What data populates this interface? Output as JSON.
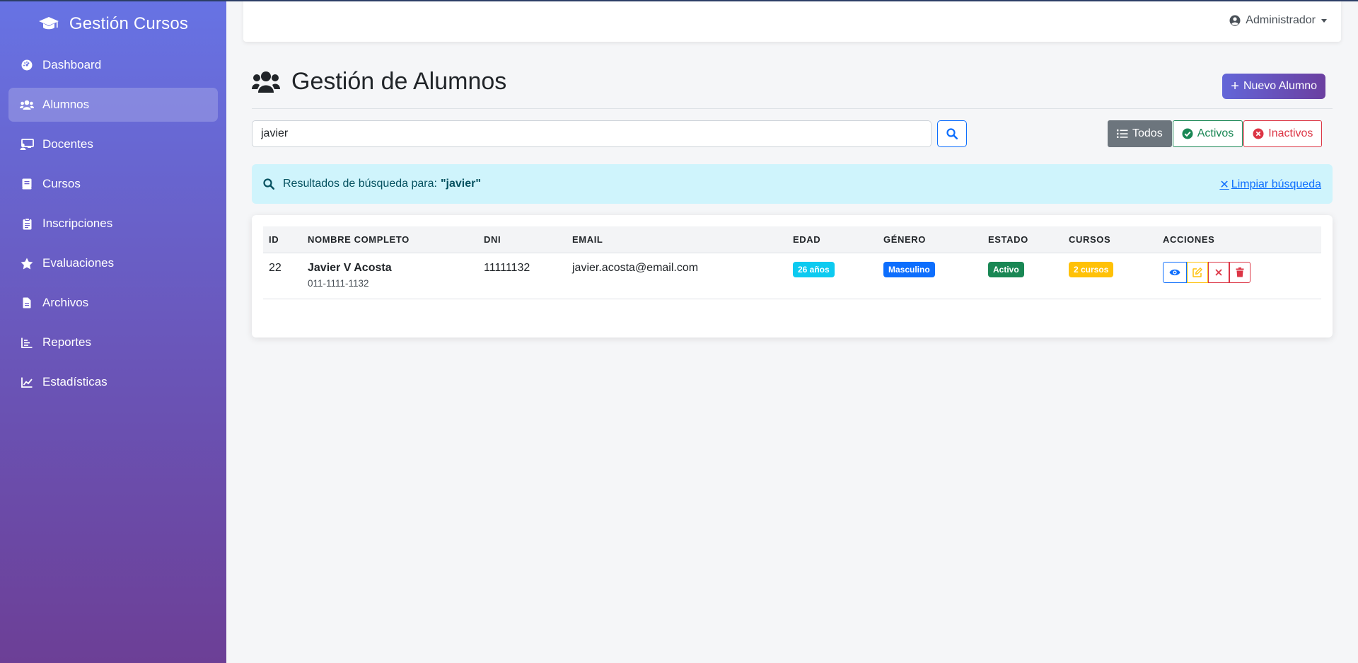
{
  "brand": {
    "title": "Gestión Cursos",
    "icon": "graduation-cap-icon"
  },
  "sidebar": {
    "items": [
      {
        "label": "Dashboard",
        "icon": "dashboard-icon",
        "active": false
      },
      {
        "label": "Alumnos",
        "icon": "users-icon",
        "active": true
      },
      {
        "label": "Docentes",
        "icon": "chalkboard-teacher-icon",
        "active": false
      },
      {
        "label": "Cursos",
        "icon": "book-icon",
        "active": false
      },
      {
        "label": "Inscripciones",
        "icon": "clipboard-icon",
        "active": false
      },
      {
        "label": "Evaluaciones",
        "icon": "star-icon",
        "active": false
      },
      {
        "label": "Archivos",
        "icon": "file-icon",
        "active": false
      },
      {
        "label": "Reportes",
        "icon": "bar-chart-icon",
        "active": false
      },
      {
        "label": "Estadísticas",
        "icon": "line-chart-icon",
        "active": false
      }
    ]
  },
  "topbar": {
    "user_label": "Administrador"
  },
  "page": {
    "title": "Gestión de Alumnos",
    "new_button": "Nuevo Alumno"
  },
  "search": {
    "value": "javier",
    "placeholder": ""
  },
  "filters": {
    "all": "Todos",
    "active": "Activos",
    "inactive": "Inactivos"
  },
  "alert": {
    "prefix": "Resultados de búsqueda para:",
    "query": "\"javier\"",
    "clear": "Limpiar búsqueda"
  },
  "table": {
    "headers": [
      "ID",
      "NOMBRE COMPLETO",
      "DNI",
      "EMAIL",
      "EDAD",
      "GÉNERO",
      "ESTADO",
      "CURSOS",
      "ACCIONES"
    ],
    "rows": [
      {
        "id": "22",
        "name": "Javier V Acosta",
        "phone": "011-1111-1132",
        "dni": "11111132",
        "email": "javier.acosta@email.com",
        "age": "26 años",
        "gender": "Masculino",
        "status": "Activo",
        "courses": "2 cursos"
      }
    ]
  },
  "colors": {
    "sidebar_top": "#6773e4",
    "sidebar_bottom": "#6c3f96",
    "primary": "#0d6efd",
    "success": "#198754",
    "danger": "#dc3545",
    "warning": "#ffc107",
    "info": "#0dcaf0",
    "secondary": "#6c757d"
  }
}
